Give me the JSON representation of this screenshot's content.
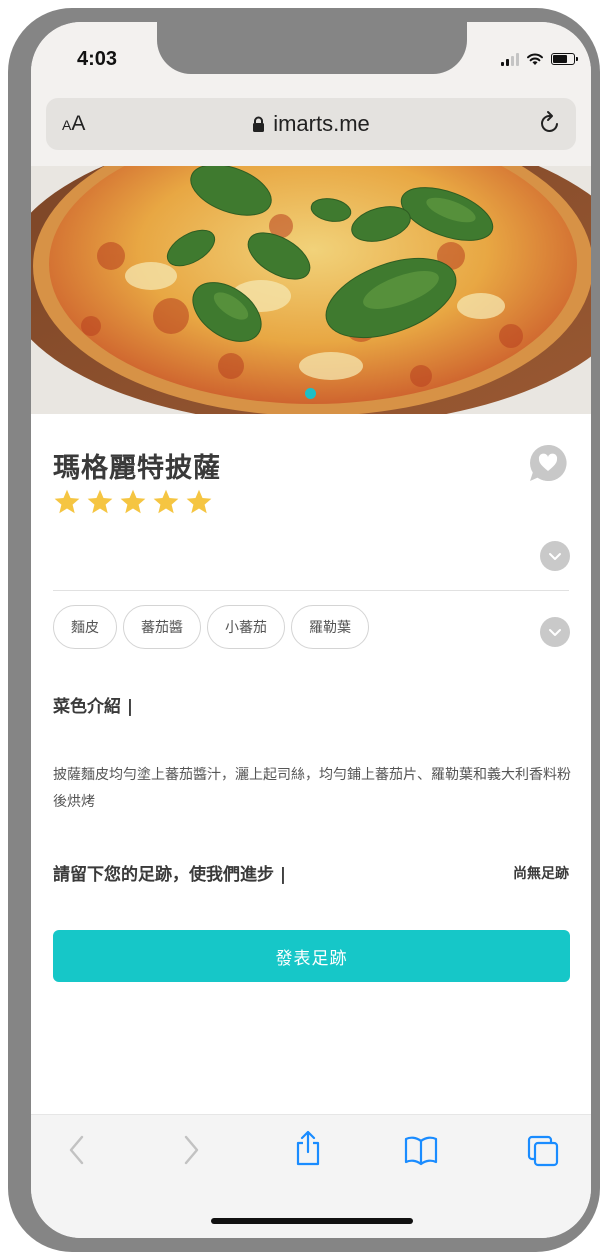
{
  "status_bar": {
    "time": "4:03",
    "battery_level": 0.72
  },
  "browser": {
    "text_size_small": "A",
    "text_size_big": "A",
    "url": "imarts.me"
  },
  "hero": {
    "image_description": "margherita pizza with basil leaves",
    "active_slide": 1,
    "slide_count": 1
  },
  "dish": {
    "title": "瑪格麗特披薩",
    "rating": 5,
    "rating_max": 5,
    "star_color": "#f5c542"
  },
  "tags": [
    "麵皮",
    "蕃茄醬",
    "小蕃茄",
    "羅勒葉"
  ],
  "intro": {
    "heading": "菜色介紹 |",
    "description": "披薩麵皮均勻塗上蕃茄醬汁，灑上起司絲，均勻鋪上蕃茄片、羅勒葉和義大利香料粉後烘烤"
  },
  "feedback": {
    "heading": "請留下您的足跡，使我們進步 |",
    "status": "尚無足跡",
    "button_label": "發表足跡"
  },
  "colors": {
    "accent": "#16c7c8",
    "dot": "#1cbfc6",
    "toolbar_blue": "#1a8cff"
  },
  "toolbar": {
    "items": [
      "back-icon",
      "forward-icon",
      "share-icon",
      "bookmarks-icon",
      "tabs-icon"
    ]
  }
}
